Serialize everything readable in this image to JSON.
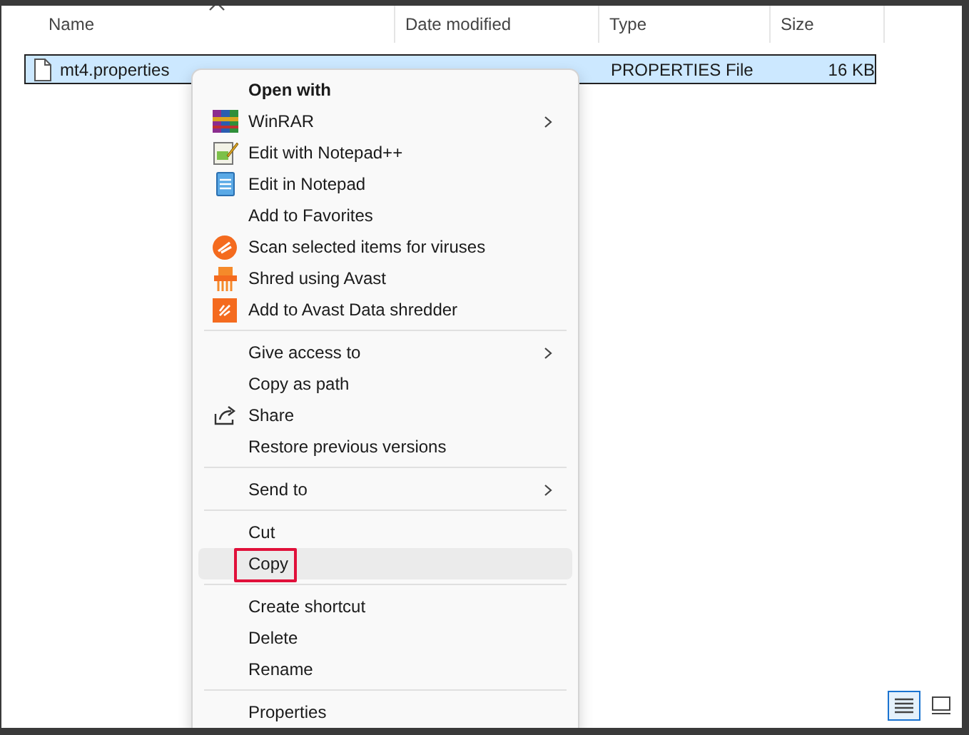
{
  "columns": [
    {
      "label": "Name",
      "sorted": true
    },
    {
      "label": "Date modified",
      "sorted": false
    },
    {
      "label": "Type",
      "sorted": false
    },
    {
      "label": "Size",
      "sorted": false
    }
  ],
  "file": {
    "name": "mt4.properties",
    "type": "PROPERTIES File",
    "size": "16 KB",
    "selected": true
  },
  "menu": [
    {
      "kind": "item",
      "label": "Open with",
      "default": true,
      "submenu": false,
      "hovered": false,
      "annotated": false
    },
    {
      "kind": "item",
      "label": "WinRAR",
      "default": false,
      "submenu": true,
      "hovered": false,
      "annotated": false
    },
    {
      "kind": "item",
      "label": "Edit with Notepad++",
      "default": false,
      "submenu": false,
      "hovered": false,
      "annotated": false
    },
    {
      "kind": "item",
      "label": "Edit in Notepad",
      "default": false,
      "submenu": false,
      "hovered": false,
      "annotated": false
    },
    {
      "kind": "item",
      "label": "Add to Favorites",
      "default": false,
      "submenu": false,
      "hovered": false,
      "annotated": false
    },
    {
      "kind": "item",
      "label": "Scan selected items for viruses",
      "default": false,
      "submenu": false,
      "hovered": false,
      "annotated": false
    },
    {
      "kind": "item",
      "label": "Shred using Avast",
      "default": false,
      "submenu": false,
      "hovered": false,
      "annotated": false
    },
    {
      "kind": "item",
      "label": "Add to Avast Data shredder",
      "default": false,
      "submenu": false,
      "hovered": false,
      "annotated": false
    },
    {
      "kind": "separator"
    },
    {
      "kind": "item",
      "label": "Give access to",
      "default": false,
      "submenu": true,
      "hovered": false,
      "annotated": false
    },
    {
      "kind": "item",
      "label": "Copy as path",
      "default": false,
      "submenu": false,
      "hovered": false,
      "annotated": false
    },
    {
      "kind": "item",
      "label": "Share",
      "default": false,
      "submenu": false,
      "hovered": false,
      "annotated": false
    },
    {
      "kind": "item",
      "label": "Restore previous versions",
      "default": false,
      "submenu": false,
      "hovered": false,
      "annotated": false
    },
    {
      "kind": "separator"
    },
    {
      "kind": "item",
      "label": "Send to",
      "default": false,
      "submenu": true,
      "hovered": false,
      "annotated": false
    },
    {
      "kind": "separator"
    },
    {
      "kind": "item",
      "label": "Cut",
      "default": false,
      "submenu": false,
      "hovered": false,
      "annotated": false
    },
    {
      "kind": "item",
      "label": "Copy",
      "default": false,
      "submenu": false,
      "hovered": true,
      "annotated": true
    },
    {
      "kind": "separator"
    },
    {
      "kind": "item",
      "label": "Create shortcut",
      "default": false,
      "submenu": false,
      "hovered": false,
      "annotated": false
    },
    {
      "kind": "item",
      "label": "Delete",
      "default": false,
      "submenu": false,
      "hovered": false,
      "annotated": false
    },
    {
      "kind": "item",
      "label": "Rename",
      "default": false,
      "submenu": false,
      "hovered": false,
      "annotated": false
    },
    {
      "kind": "separator"
    },
    {
      "kind": "item",
      "label": "Properties",
      "default": false,
      "submenu": false,
      "hovered": false,
      "annotated": false
    }
  ],
  "views": [
    {
      "kind": "details",
      "selected": true
    },
    {
      "kind": "large",
      "selected": false
    }
  ]
}
